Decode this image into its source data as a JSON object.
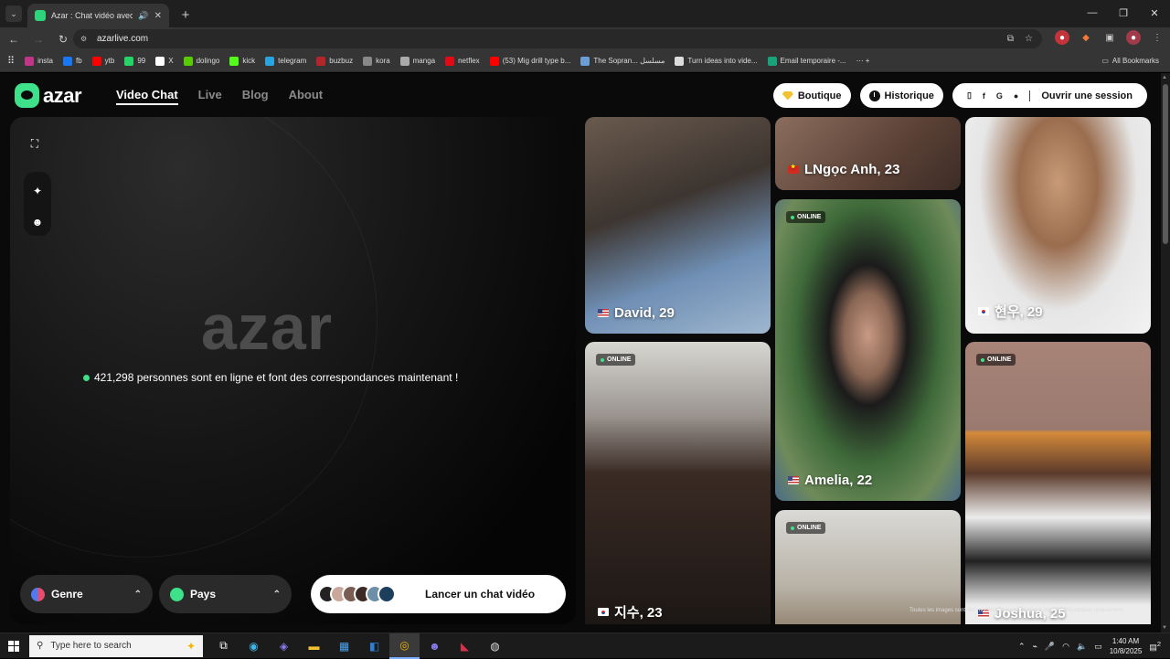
{
  "browser": {
    "tab_title": "Azar : Chat vidéo avec de n",
    "url": "azarlive.com",
    "bookmarks": [
      {
        "label": "insta",
        "color": "#c13584"
      },
      {
        "label": "fb",
        "color": "#1877f2"
      },
      {
        "label": "ytb",
        "color": "#ff0000"
      },
      {
        "label": "99",
        "color": "#25d366"
      },
      {
        "label": "X",
        "color": "#ffffff"
      },
      {
        "label": "dolingo",
        "color": "#58cc02"
      },
      {
        "label": "kick",
        "color": "#53fc18"
      },
      {
        "label": "telegram",
        "color": "#2aa3df"
      },
      {
        "label": "buzbuz",
        "color": "#b3262b"
      },
      {
        "label": "kora",
        "color": "#888888"
      },
      {
        "label": "manga",
        "color": "#aaaaaa"
      },
      {
        "label": "netflex",
        "color": "#e50914"
      },
      {
        "label": "(53) Mig drill type b...",
        "color": "#ff0000"
      },
      {
        "label": "The Sopran... مسلسل",
        "color": "#6b9dd6"
      },
      {
        "label": "Turn ideas into vide...",
        "color": "#dddddd"
      },
      {
        "label": "Email temporaire -...",
        "color": "#19a37a"
      }
    ],
    "all_bookmarks": "All Bookmarks"
  },
  "header": {
    "logo": "azar",
    "nav": [
      "Video Chat",
      "Live",
      "Blog",
      "About"
    ],
    "shop": "Boutique",
    "history": "Historique",
    "login_icons": [
      "▯",
      "f",
      "G",
      ""
    ],
    "login": "Ouvrir une session"
  },
  "panel": {
    "big_logo": "azar",
    "online_text": "421,298 personnes sont en ligne et font des correspondances maintenant !",
    "genre": "Genre",
    "country": "Pays",
    "start": "Lancer un chat vidéo",
    "avatar_colors": [
      "#222",
      "#c9a79a",
      "#7b5c52",
      "#3b2a26",
      "#6d8fa8",
      "#1d3f5e"
    ]
  },
  "grid": {
    "online_label": "ONLINE",
    "cards": [
      {
        "name": "David, 29",
        "flag": "us"
      },
      {
        "name": "LNgọc Anh, 23",
        "flag": "vn"
      },
      {
        "name": "현우, 29",
        "flag": "kr"
      },
      {
        "name": "Amelia, 22",
        "flag": "us"
      },
      {
        "name": "지수, 23",
        "flag": "kr"
      },
      {
        "name": "Joshua, 25",
        "flag": "us"
      }
    ],
    "disclaimer": "Toutes les images sont des modèles et sont utilisées à des fins d'illustration uniquement."
  },
  "taskbar": {
    "search_placeholder": "Type here to search",
    "time": "1:40 AM",
    "date": "10/8/2025",
    "notif": "2"
  }
}
